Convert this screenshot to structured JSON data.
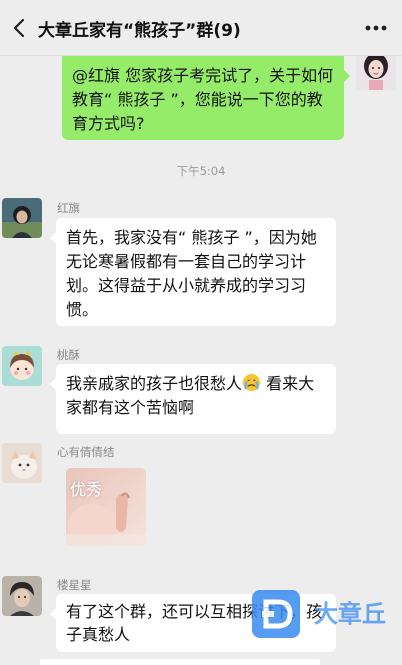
{
  "header": {
    "title": "大章丘家有“熊孩子”群(9)"
  },
  "messages": {
    "m1": {
      "text": "@红旗  您家孩子考完试了，关于如何教育“ 熊孩子 ”，您能说一下您的教育方式吗?"
    },
    "timestamp": "下午5:04",
    "m2": {
      "sender": "红旗",
      "text": "首先，我家没有“ 熊孩子 ”，因为她无论寒暑假都有一套自己的学习计划。这得益于从小就养成的学习习惯。"
    },
    "m3": {
      "sender": "桃酥",
      "text_before": "我亲戚家的孩子也很愁人",
      "emoji": "crying-emoji",
      "text_after": " 看来大家都有这个苦恼啊"
    },
    "m4": {
      "sender": "心有倩倩结",
      "image_caption": "优秀"
    },
    "m5": {
      "sender": "楼星星",
      "text": "有了这个群，还可以互相探讨下，孩子真愁人"
    }
  },
  "watermark": {
    "text": "大章丘",
    "icon": "d-logo-icon"
  },
  "colors": {
    "background": "#ededed",
    "self_bubble": "#95ec69",
    "other_bubble": "#ffffff",
    "watermark": "#3a8bf2"
  }
}
